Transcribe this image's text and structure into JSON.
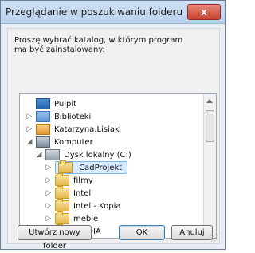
{
  "window": {
    "title": "Przeglądanie w poszukiwaniu folderu",
    "close_glyph": "x"
  },
  "dialog": {
    "prompt": "Proszę wybrać katalog, w którym program ma być zainstalowany:"
  },
  "tree": {
    "items": [
      {
        "label": "Pulpit",
        "icon": "desktop-icon",
        "expander": ""
      },
      {
        "label": "Biblioteki",
        "icon": "libraries-icon",
        "expander": "▷"
      },
      {
        "label": "Katarzyna.Lisiak",
        "icon": "user-folder-icon",
        "expander": "▷"
      },
      {
        "label": "Komputer",
        "icon": "computer-icon",
        "expander": "◢"
      },
      {
        "label": "Dysk lokalny (C:)",
        "icon": "local-disk-icon",
        "expander": "◢"
      },
      {
        "label": "CadProjekt",
        "icon": "folder-icon",
        "expander": "▷"
      },
      {
        "label": "filmy",
        "icon": "folder-icon",
        "expander": "▷"
      },
      {
        "label": "Intel",
        "icon": "folder-icon",
        "expander": "▷"
      },
      {
        "label": "Intel - Kopia",
        "icon": "folder-icon",
        "expander": "▷"
      },
      {
        "label": "meble",
        "icon": "folder-icon",
        "expander": "▷"
      },
      {
        "label": "NVIDIA",
        "icon": "folder-icon",
        "expander": "▷"
      }
    ]
  },
  "buttons": {
    "new_folder": "Utwórz nowy folder",
    "ok": "OK",
    "cancel": "Anuluj"
  }
}
